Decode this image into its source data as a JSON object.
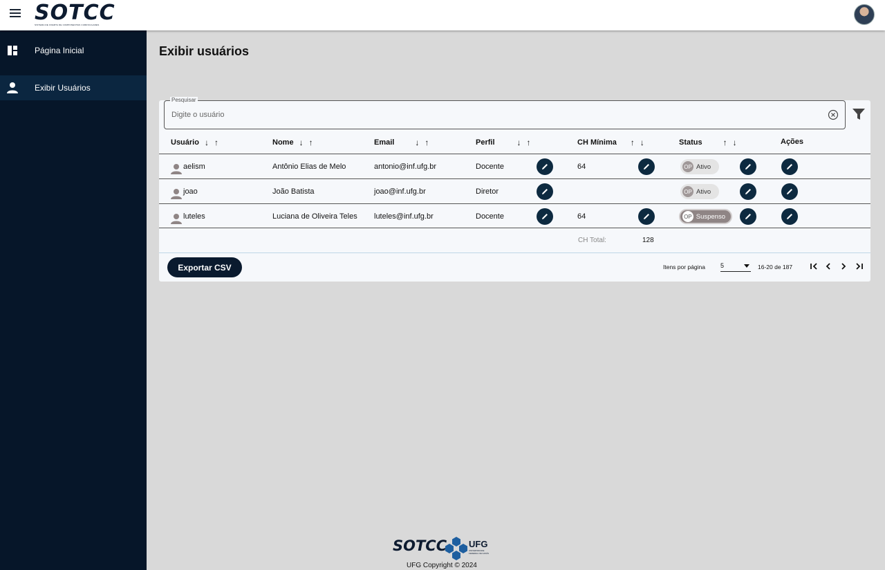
{
  "topbar": {
    "logo_text": "SOTCC",
    "logo_subtitle": "SISTEMA DE OFERTA DE COMPONENTES CURRICULARES"
  },
  "sidebar": {
    "items": [
      {
        "label": "Página Inicial",
        "icon": "dashboard-icon",
        "active": false
      },
      {
        "label": "Exibir Usuários",
        "icon": "person-icon",
        "active": true
      }
    ]
  },
  "page": {
    "title": "Exibir usuários"
  },
  "search": {
    "legend": "Pesquisar",
    "placeholder": "Digite o usuário",
    "value": ""
  },
  "table": {
    "headers": {
      "usuario": "Usuário",
      "nome": "Nome",
      "email": "Email",
      "perfil": "Perfil",
      "ch_minima": "CH Mínima",
      "status": "Status",
      "acoes": "Ações"
    },
    "rows": [
      {
        "usuario": "aelism",
        "nome": "Antônio Elias de Melo",
        "email": "antonio@inf.ufg.br",
        "perfil": "Docente",
        "ch_minima": "64",
        "status": "Ativo",
        "status_badge": "OP"
      },
      {
        "usuario": "joao",
        "nome": "João Batista",
        "email": "joao@inf.ufg.br",
        "perfil": "Diretor",
        "ch_minima": "",
        "status": "Ativo",
        "status_badge": "OP"
      },
      {
        "usuario": "luteles",
        "nome": "Luciana de Oliveira Teles",
        "email": "luteles@inf.ufg.br",
        "perfil": "Docente",
        "ch_minima": "64",
        "status": "Suspenso",
        "status_badge": "OP"
      }
    ],
    "total_label": "CH Total:",
    "total_value": "128"
  },
  "actions": {
    "export_label": "Exportar CSV"
  },
  "pagination": {
    "items_per_page_label": "Itens por página",
    "items_per_page": "5",
    "range": "16-20 de 187"
  },
  "footer": {
    "logo_text": "SOTCC",
    "ufg_text": "UFG",
    "ufg_subtitle": "UNIVERSIDADE FEDERAL DE GOIÁS",
    "copyright": "UFG Copyright © 2024"
  },
  "colors": {
    "sidebar_bg": "#061629",
    "sidebar_active": "#0b2640",
    "accent_dark": "#0d2a40",
    "page_bg": "#d9d9d9",
    "suspended": "#8f8585"
  }
}
